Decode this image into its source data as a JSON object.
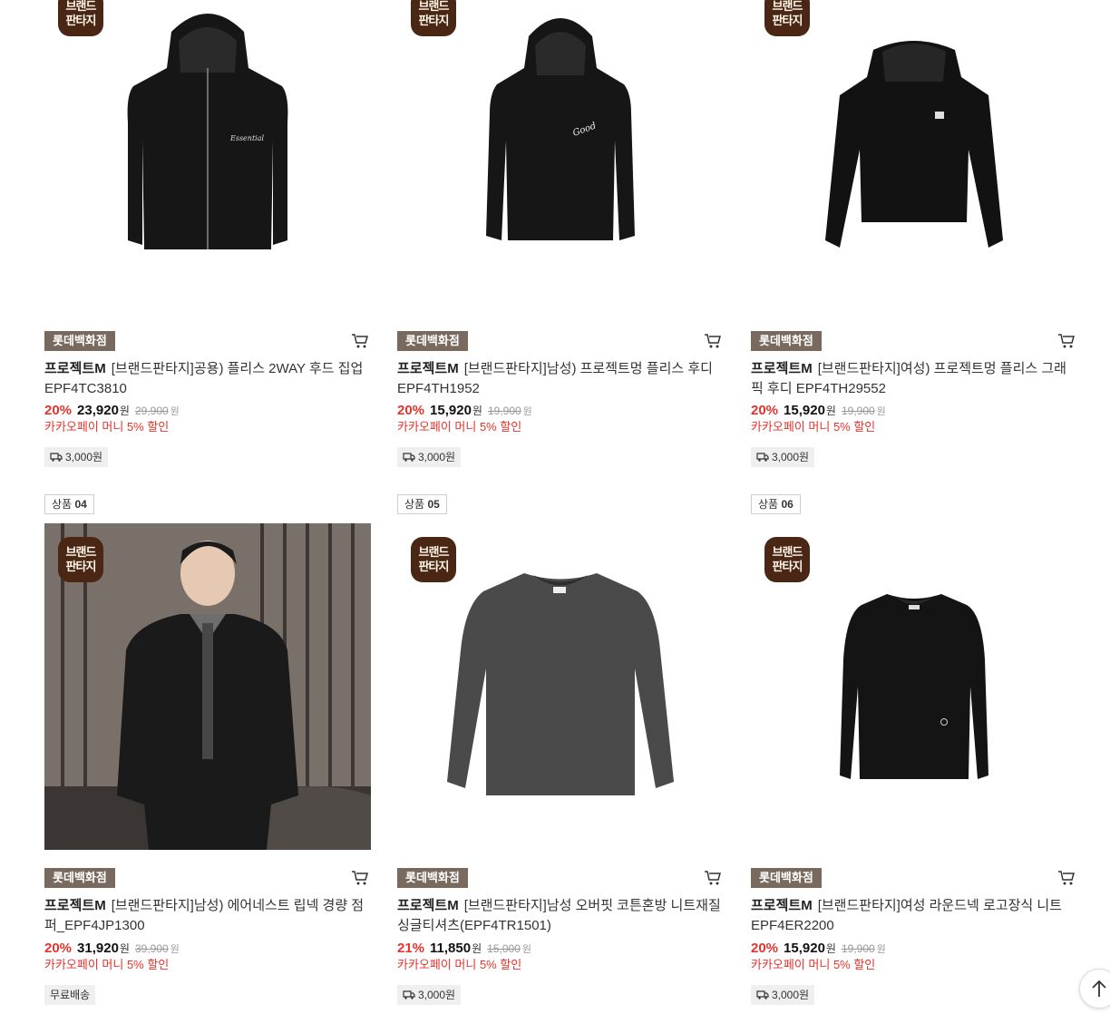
{
  "products": [
    {
      "rank_prefix": "",
      "rank_num": "",
      "seller": "롯데백화점",
      "brand": "프로젝트M",
      "name": "[브랜드판타지]공용) 플리스 2WAY 후드 집업 EPF4TC3810",
      "discount": "20%",
      "price": "23,920",
      "price_unit": "원",
      "original": "29,900",
      "original_unit": "원",
      "promo": "카카오페이 머니 5% 할인",
      "shipping": "3,000원",
      "badge": [
        "브랜드",
        "판타지"
      ],
      "image": "black zip-up hoodie",
      "image_color": "#161616"
    },
    {
      "rank_prefix": "",
      "rank_num": "",
      "seller": "롯데백화점",
      "brand": "프로젝트M",
      "name": "[브랜드판타지]남성) 프로젝트멍 플리스 후디 EPF4TH1952",
      "discount": "20%",
      "price": "15,920",
      "price_unit": "원",
      "original": "19,900",
      "original_unit": "원",
      "promo": "카카오페이 머니 5% 할인",
      "shipping": "3,000원",
      "badge": [
        "브랜드",
        "판타지"
      ],
      "image": "black hoodie graphic",
      "image_color": "#161616"
    },
    {
      "rank_prefix": "",
      "rank_num": "",
      "seller": "롯데백화점",
      "brand": "프로젝트M",
      "name": "[브랜드판타지]여성) 프로젝트멍 플리스 그래픽 후디 EPF4TH29552",
      "discount": "20%",
      "price": "15,920",
      "price_unit": "원",
      "original": "19,900",
      "original_unit": "원",
      "promo": "카카오페이 머니 5% 할인",
      "shipping": "3,000원",
      "badge": [
        "브랜드",
        "판타지"
      ],
      "image": "black women hoodie",
      "image_color": "#121212"
    },
    {
      "rank_prefix": "상품",
      "rank_num": "04",
      "seller": "롯데백화점",
      "brand": "프로젝트M",
      "name": "[브랜드판타지]남성) 에어네스트 립넥 경량 점퍼_EPF4JP1300",
      "discount": "20%",
      "price": "31,920",
      "price_unit": "원",
      "original": "39,900",
      "original_unit": "원",
      "promo": "카카오페이 머니 5% 할인",
      "shipping": "무료배송",
      "badge": [
        "브랜드",
        "판타지"
      ],
      "image": "model in black padded jacket",
      "image_color": "#1a1a1a"
    },
    {
      "rank_prefix": "상품",
      "rank_num": "05",
      "seller": "롯데백화점",
      "brand": "프로젝트M",
      "name": "[브랜드판타지]남성 오버핏 코튼혼방 니트재질 싱글티셔츠(EPF4TR1501)",
      "discount": "21%",
      "price": "11,850",
      "price_unit": "원",
      "original": "15,000",
      "original_unit": "원",
      "promo": "카카오페이 머니 5% 할인",
      "shipping": "3,000원",
      "badge": [
        "브랜드",
        "판타지"
      ],
      "image": "charcoal long sleeve tee",
      "image_color": "#4a4a4a"
    },
    {
      "rank_prefix": "상품",
      "rank_num": "06",
      "seller": "롯데백화점",
      "brand": "프로젝트M",
      "name": "[브랜드판타지]여성 라운드넥 로고장식 니트 EPF4ER2200",
      "discount": "20%",
      "price": "15,920",
      "price_unit": "원",
      "original": "19,900",
      "original_unit": "원",
      "promo": "카카오페이 머니 5% 할인",
      "shipping": "3,000원",
      "badge": [
        "브랜드",
        "판타지"
      ],
      "image": "black round neck knit",
      "image_color": "#141414"
    }
  ],
  "icons": {
    "cart": "cart-icon",
    "truck": "truck-icon",
    "top": "arrow-up-icon"
  },
  "colors": {
    "discount": "#e8322b",
    "seller_tag": "#7a6a5e",
    "badge": "#4a2614"
  }
}
